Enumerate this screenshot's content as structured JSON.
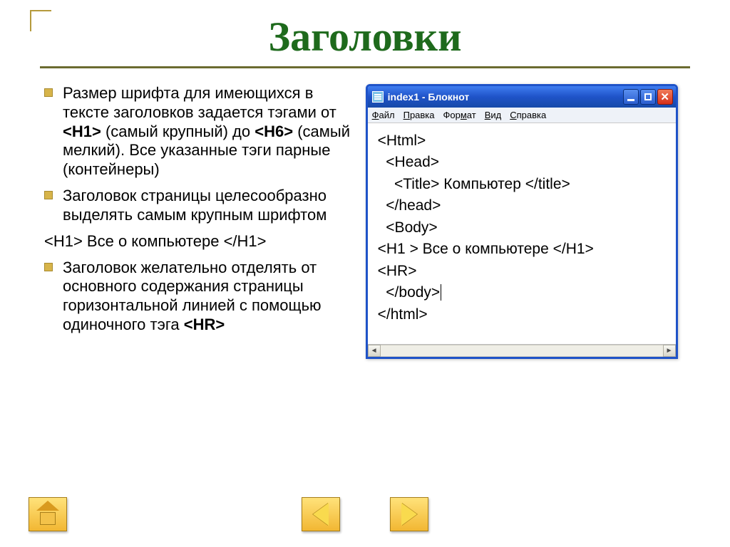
{
  "title": "Заголовки",
  "bullets": {
    "b1_pre": "Размер шрифта для имеющихся в тексте заголовков задается тэгами от ",
    "b1_h1": "<H1>",
    "b1_mid1": " (самый крупный) до ",
    "b1_h6": "<H6>",
    "b1_post": " (самый мелкий). Все указанные тэги парные (контейнеры)",
    "b2": "Заголовок страницы целесообразно выделять самым крупным шрифтом",
    "code_line": "<H1> Все о компьютере </H1>",
    "b3_pre": "Заголовок желательно отделять от основного содержания страницы горизонтальной линией с помощью одиночного тэга ",
    "b3_hr": "<HR>"
  },
  "notepad": {
    "window_title": "index1 - Блокнот",
    "menu": {
      "file": "Файл",
      "edit": "Правка",
      "format": "Формат",
      "view": "Вид",
      "help": "Справка"
    },
    "lines": {
      "l1": "<Html>",
      "l2": "  <Head>",
      "l3": "    <Title> Компьютер </title>",
      "l4": "  </head>",
      "l5": "  <Body>",
      "l6": "<H1 > Все о компьютере </H1>",
      "l7": "<HR>",
      "l8": "  </body>",
      "l9": "</html>"
    }
  },
  "nav": {
    "home": "home",
    "prev": "previous",
    "next": "next"
  }
}
